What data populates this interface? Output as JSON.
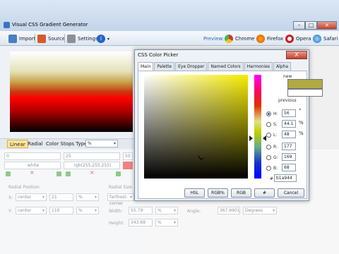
{
  "app": {
    "title": "Visual CSS Gradient Generator"
  },
  "toolbar": {
    "import_label": "Import",
    "source_label": "Source",
    "settings_label": "Settings",
    "preview_label": "Preview:",
    "browsers": [
      "Chrome",
      "Firefox",
      "Opera",
      "Safari"
    ]
  },
  "gradient_tabs": {
    "linear": "Linear",
    "radial": "Radial",
    "stops_type_label": "Color Stops Type:",
    "stops_type_value": "%"
  },
  "stops": [
    {
      "position": "0",
      "color": "white"
    },
    {
      "position": "25",
      "color": "rgb(255,255,255)"
    },
    {
      "position": "50",
      "color": ""
    }
  ],
  "radial": {
    "position_label": "Radial Position",
    "size_label": "Radial Size",
    "x_label": "X:",
    "y_label": "Y:",
    "x_anchor": "center",
    "y_anchor": "center",
    "x_value": "21",
    "y_value": "110",
    "x_unit": "%",
    "y_unit": "%",
    "size_value": "farthest-corner",
    "width_label": "Width:",
    "width_value": "55.79",
    "width_unit": "%",
    "height_label": "Height:",
    "height_value": "343.69",
    "height_unit": "%",
    "angle_label": "Angle:",
    "angle_value": "367.6901",
    "angle_unit": "Degrees"
  },
  "dialog": {
    "title": "CSS Color Picker",
    "close_label": "X",
    "tabs": [
      "Main",
      "Palette",
      "Eye Dropper",
      "Named Colors",
      "Harmonies",
      "Alpha"
    ],
    "new_label": "new",
    "previous_label": "previous",
    "new_color": "#b1a944",
    "previous_color": "#ffffff",
    "fields": [
      {
        "label": "H:",
        "value": "56",
        "unit": "°"
      },
      {
        "label": "S:",
        "value": "44.1",
        "unit": "%"
      },
      {
        "label": "L:",
        "value": "48",
        "unit": "%"
      },
      {
        "label": "R:",
        "value": "177",
        "unit": ""
      },
      {
        "label": "G:",
        "value": "169",
        "unit": ""
      },
      {
        "label": "B:",
        "value": "68",
        "unit": ""
      }
    ],
    "hex_label": "#",
    "hex_value": "b1a944",
    "buttons": [
      "HSL",
      "RGB%",
      "RGB",
      "#",
      "Cancel"
    ]
  }
}
